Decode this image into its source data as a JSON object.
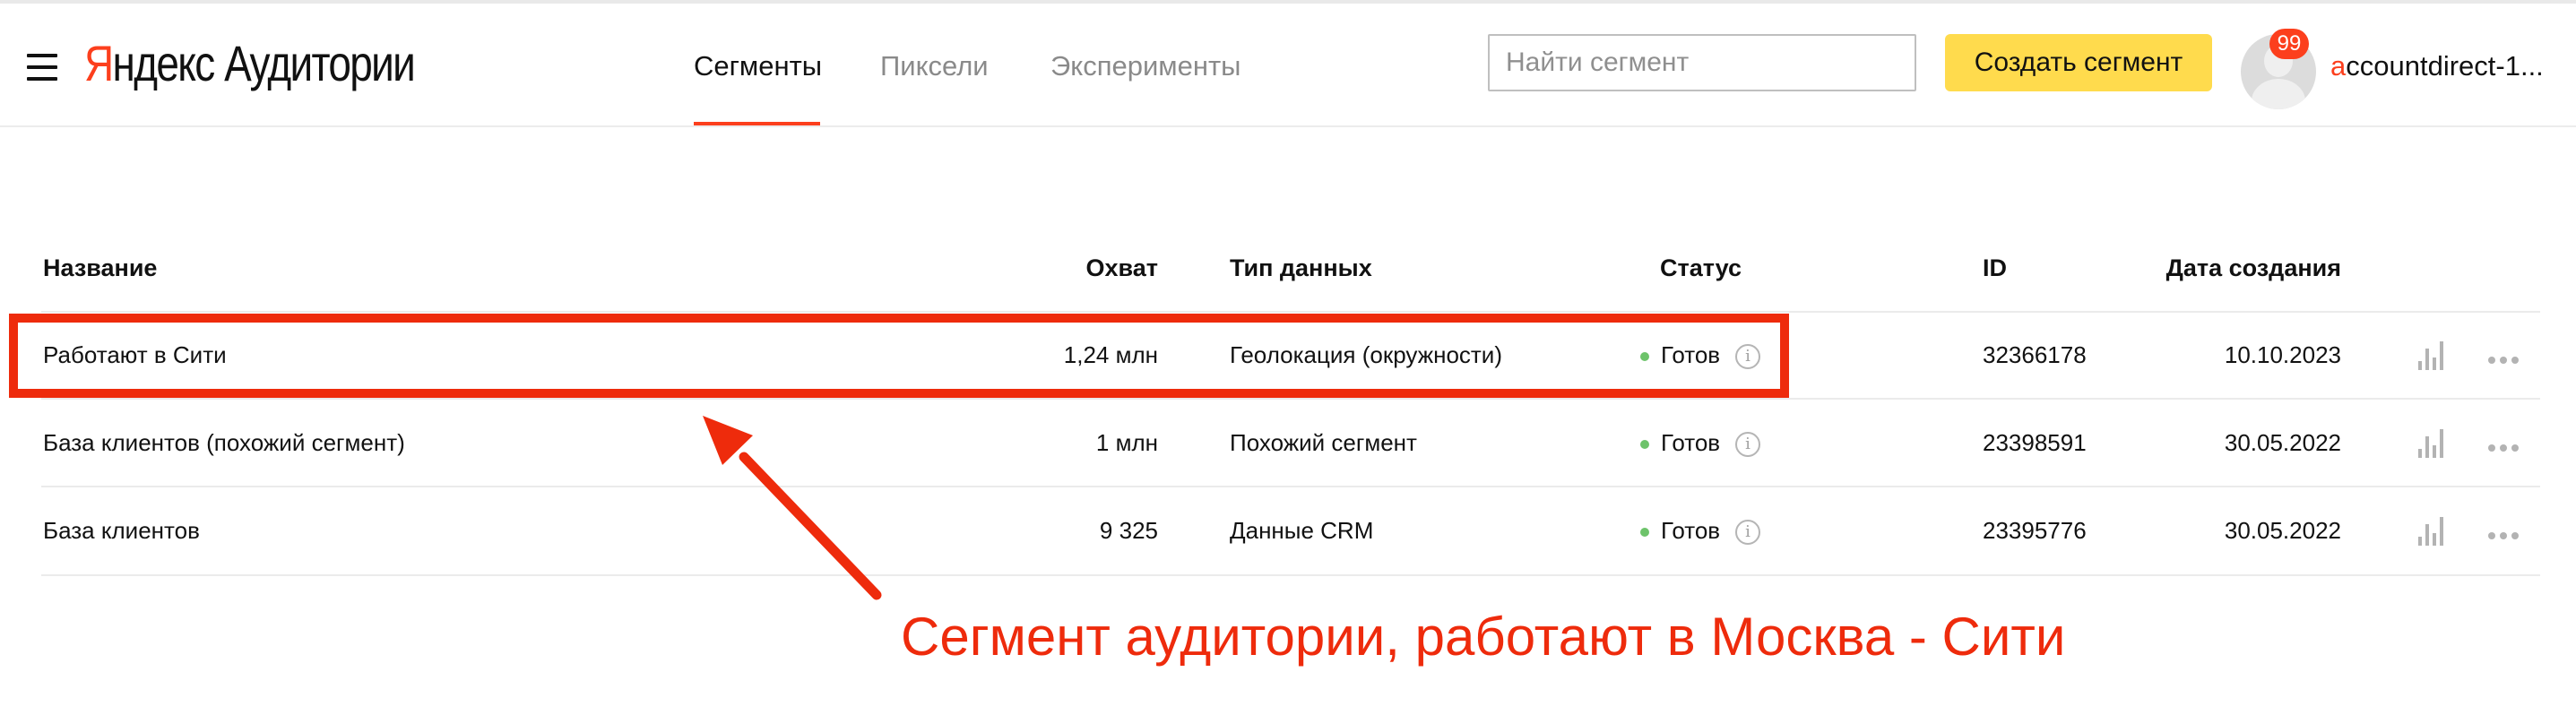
{
  "header": {
    "logo_brand": "Яндекс",
    "logo_product": "Аудитории",
    "tabs": [
      {
        "label": "Сегменты",
        "active": true
      },
      {
        "label": "Пиксели",
        "active": false
      },
      {
        "label": "Эксперименты",
        "active": false
      }
    ],
    "search_placeholder": "Найти сегмент",
    "create_button": "Создать сегмент",
    "notifications_count": "99",
    "account_first_letter": "a",
    "account_rest": "ccountdirect-1..."
  },
  "table": {
    "columns": {
      "name": "Название",
      "reach": "Охват",
      "data_type": "Тип данных",
      "status": "Статус",
      "id": "ID",
      "created": "Дата создания"
    },
    "rows": [
      {
        "name": "Работают в Сити",
        "reach": "1,24 млн",
        "data_type": "Геолокация (окружности)",
        "status": "Готов",
        "id": "32366178",
        "created": "10.10.2023"
      },
      {
        "name": "База клиентов (похожий сегмент)",
        "reach": "1 млн",
        "data_type": "Похожий сегмент",
        "status": "Готов",
        "id": "23398591",
        "created": "30.05.2022"
      },
      {
        "name": "База клиентов",
        "reach": "9 325",
        "data_type": "Данные CRM",
        "status": "Готов",
        "id": "23395776",
        "created": "30.05.2022"
      }
    ]
  },
  "annotation": {
    "caption": "Сегмент аудитории, работают в Москва - Сити",
    "color": "#ee2b0c"
  },
  "colors": {
    "accent_red": "#fc3f1d",
    "button_yellow": "#ffdb4d",
    "status_green": "#6dc36a"
  }
}
